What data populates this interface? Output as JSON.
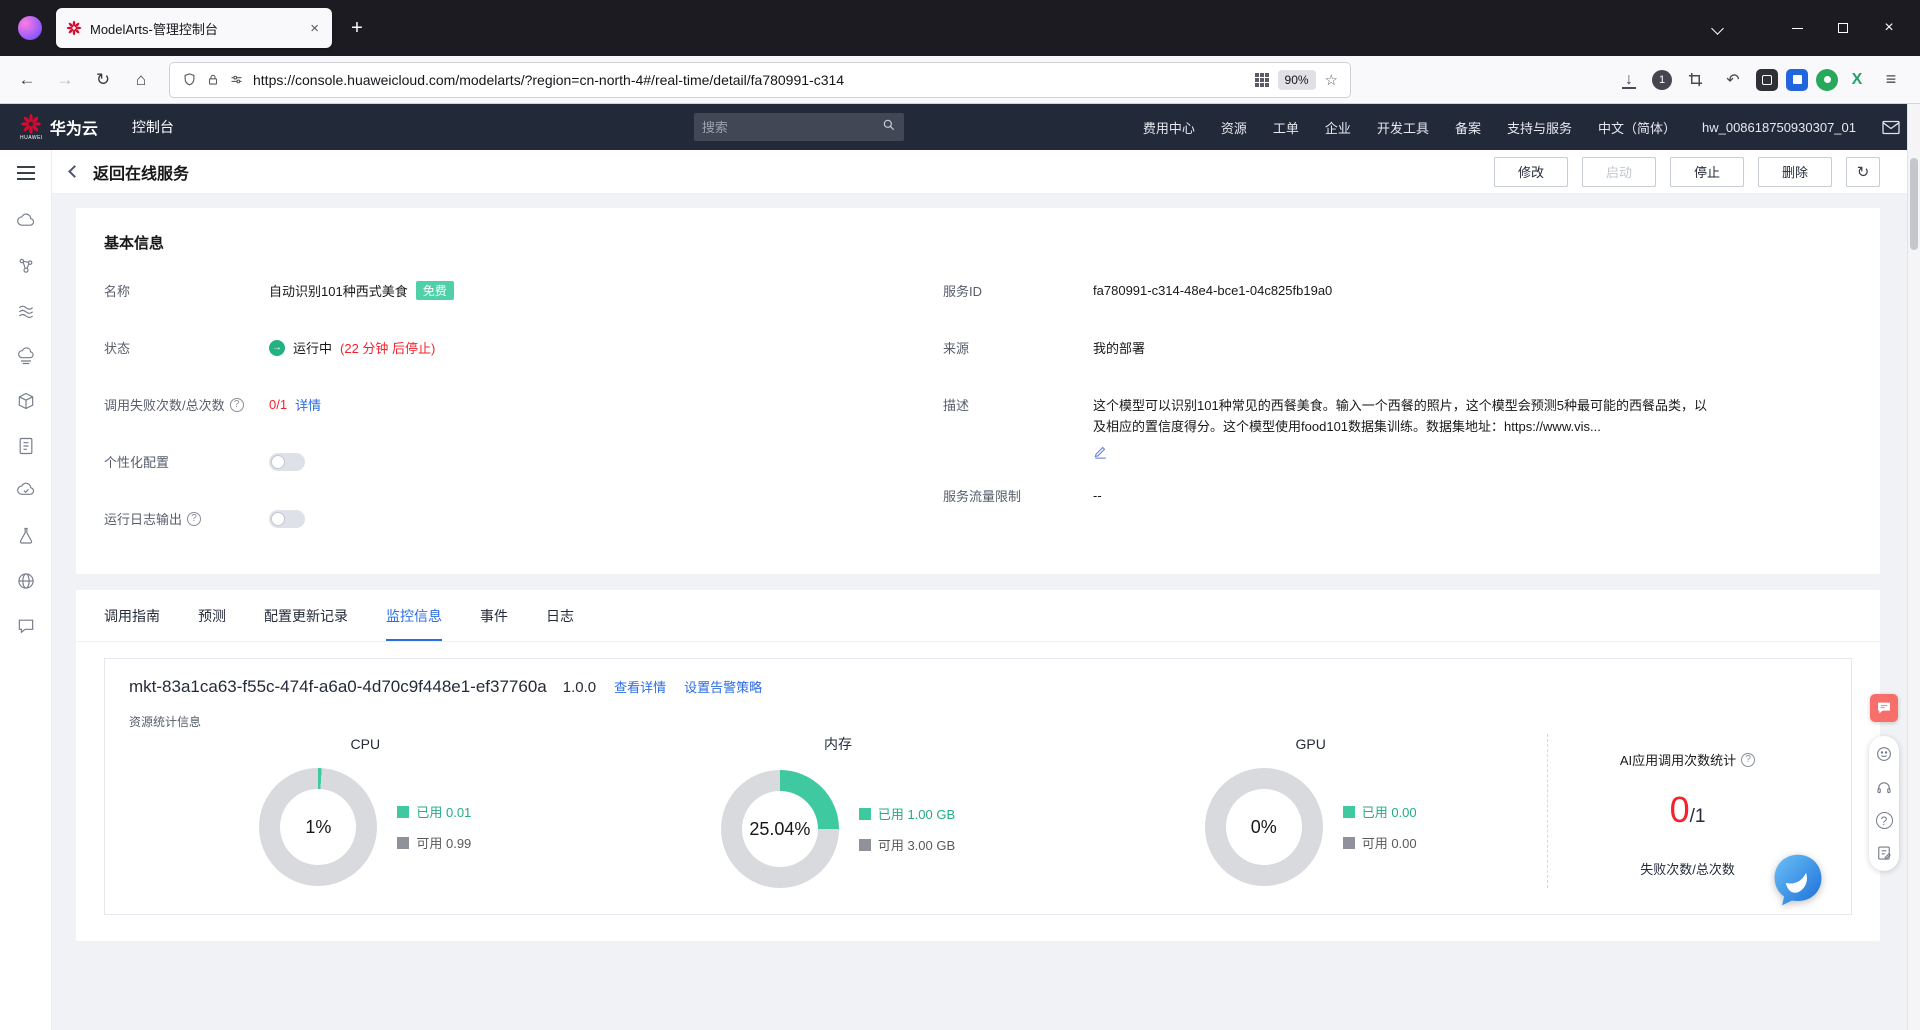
{
  "colors": {
    "accent_green": "#3fc9a0",
    "badge_green": "#4fd0a8",
    "used_text_green": "#23ab85",
    "link_blue": "#2b6de5",
    "alert_red": "#f5222d",
    "brand_red": "#d40b2e",
    "header_dark": "#222939",
    "donut_gray": "#d9dade"
  },
  "icons": {
    "close": "×",
    "plus": "+",
    "back": "←",
    "forward": "→",
    "reload": "↻",
    "home": "⌂",
    "download": "↓",
    "undo": "↶",
    "star": "☆",
    "menu": "≡",
    "question": "?",
    "arrow_right": "→",
    "ext_x": "X"
  },
  "browser": {
    "tab_title": "ModelArts-管理控制台",
    "url": "https://console.huaweicloud.com/modelarts/?region=cn-north-4#/real-time/detail/fa780991-c314",
    "zoom_level": "90%",
    "download_badge": "1"
  },
  "console_header": {
    "brand": "华为云",
    "brand_mark": "HUAWEI",
    "console_label": "控制台",
    "search_placeholder": "搜索",
    "nav": [
      "费用中心",
      "资源",
      "工单",
      "企业",
      "开发工具",
      "备案",
      "支持与服务",
      "中文（简体）",
      "hw_008618750930307_01"
    ]
  },
  "page_header": {
    "back_label": "返回在线服务",
    "modify": "修改",
    "start": "启动",
    "stop": "停止",
    "delete": "删除"
  },
  "basic": {
    "title": "基本信息",
    "name_label": "名称",
    "name_value": "自动识别101种西式美食",
    "name_badge": "免费",
    "status_label": "状态",
    "status_value": "运行中",
    "status_note": "(22 分钟 后停止)",
    "fail_label": "调用失败次数/总次数",
    "fail_value": "0/1",
    "fail_link": "详情",
    "personal_label": "个性化配置",
    "log_label": "运行日志输出",
    "service_id_label": "服务ID",
    "service_id_value": "fa780991-c314-48e4-bce1-04c825fb19a0",
    "source_label": "来源",
    "source_value": "我的部署",
    "desc_label": "描述",
    "desc_value": "这个模型可以识别101种常见的西餐美食。输入一个西餐的照片，这个模型会预测5种最可能的西餐品类，以及相应的置信度得分。这个模型使用food101数据集训练。数据集地址：https://www.vis...",
    "traffic_label": "服务流量限制",
    "traffic_value": "--"
  },
  "tabs": [
    "调用指南",
    "预测",
    "配置更新记录",
    "监控信息",
    "事件",
    "日志"
  ],
  "monitor": {
    "instance_id": "mkt-83a1ca63-f55c-474f-a6a0-4d70c9f448e1-ef37760a",
    "version": "1.0.0",
    "view_detail": "查看详情",
    "set_alarm": "设置告警策略",
    "section_label": "资源统计信息",
    "charts": [
      {
        "title": "CPU",
        "percent": "1%",
        "value": 1,
        "used": "已用 0.01",
        "free": "可用 0.99"
      },
      {
        "title": "内存",
        "percent": "25.04%",
        "value": 25.04,
        "used": "已用 1.00 GB",
        "free": "可用 3.00 GB"
      },
      {
        "title": "GPU",
        "percent": "0%",
        "value": 0,
        "used": "已用 0.00",
        "free": "可用 0.00"
      }
    ],
    "calls": {
      "title": "AI应用调用次数统计",
      "fail": "0",
      "total": "/1",
      "caption": "失败次数/总次数"
    }
  }
}
